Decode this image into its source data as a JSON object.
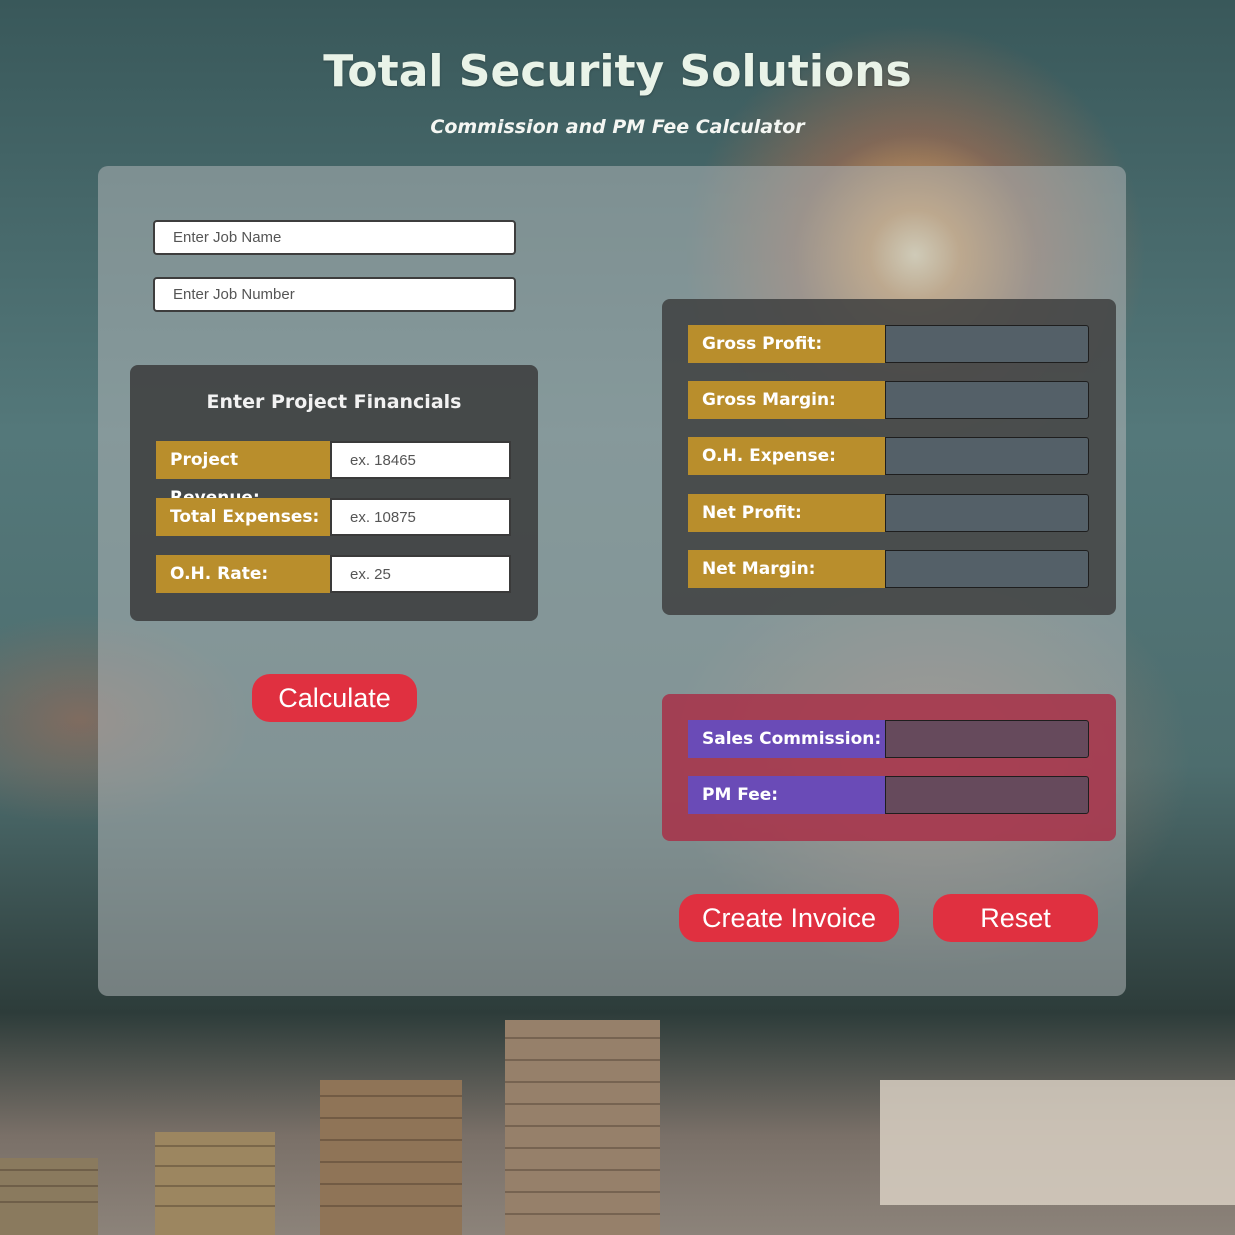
{
  "header": {
    "title": "Total Security Solutions",
    "subtitle": "Commission and PM Fee Calculator"
  },
  "job": {
    "name_placeholder": "Enter Job Name",
    "number_placeholder": "Enter Job Number"
  },
  "financials": {
    "title": "Enter Project Financials",
    "fields": [
      {
        "label": "Project Revenue:",
        "placeholder": "ex. 18465"
      },
      {
        "label": "Total Expenses:",
        "placeholder": "ex. 10875"
      },
      {
        "label": "O.H. Rate:",
        "placeholder": "ex. 25"
      }
    ]
  },
  "results": {
    "rows": [
      {
        "label": "Gross Profit:"
      },
      {
        "label": "Gross Margin:"
      },
      {
        "label": "O.H. Expense:"
      },
      {
        "label": "Net Profit:"
      },
      {
        "label": "Net Margin:"
      }
    ]
  },
  "commission": {
    "rows": [
      {
        "label": "Sales Commission:"
      },
      {
        "label": "PM Fee:"
      }
    ]
  },
  "buttons": {
    "calculate": "Calculate",
    "create_invoice": "Create Invoice",
    "reset": "Reset"
  },
  "colors": {
    "accent_red": "#e03040",
    "label_gold": "#b98e2c",
    "label_purple": "#6a4bb7"
  }
}
